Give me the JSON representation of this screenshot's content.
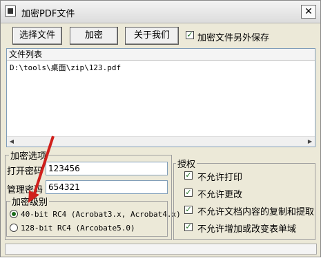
{
  "window": {
    "title": "加密PDF文件",
    "close_glyph": "✕"
  },
  "toolbar": {
    "select_file": "选择文件",
    "encrypt": "加密",
    "about": "关于我们",
    "save_as_checkbox": {
      "label": "加密文件另外保存",
      "checked": true
    }
  },
  "file_list": {
    "header": "文件列表",
    "files": [
      "D:\\tools\\桌面\\zip\\123.pdf"
    ]
  },
  "encryption": {
    "group_title": "加密选项",
    "open_password_label": "打开密码",
    "open_password_value": "123456",
    "admin_password_label": "管理密码",
    "admin_password_value": "654321",
    "level": {
      "group_title": "加密级别",
      "options": [
        "40-bit RC4 (Acrobat3.x, Acrobat4.x)",
        "128-bit RC4 (Arcobate5.0)"
      ],
      "selected_index": 0
    }
  },
  "permissions": {
    "group_title": "授权",
    "items": [
      {
        "label": "不允许打印",
        "checked": true
      },
      {
        "label": "不允许更改",
        "checked": true
      },
      {
        "label": "不允许文档内容的复制和提取",
        "checked": true
      },
      {
        "label": "不允许增加或改变表单域",
        "checked": true
      }
    ]
  },
  "colors": {
    "annotation_arrow": "#d0201c",
    "check_mark": "#1a6b1a"
  }
}
